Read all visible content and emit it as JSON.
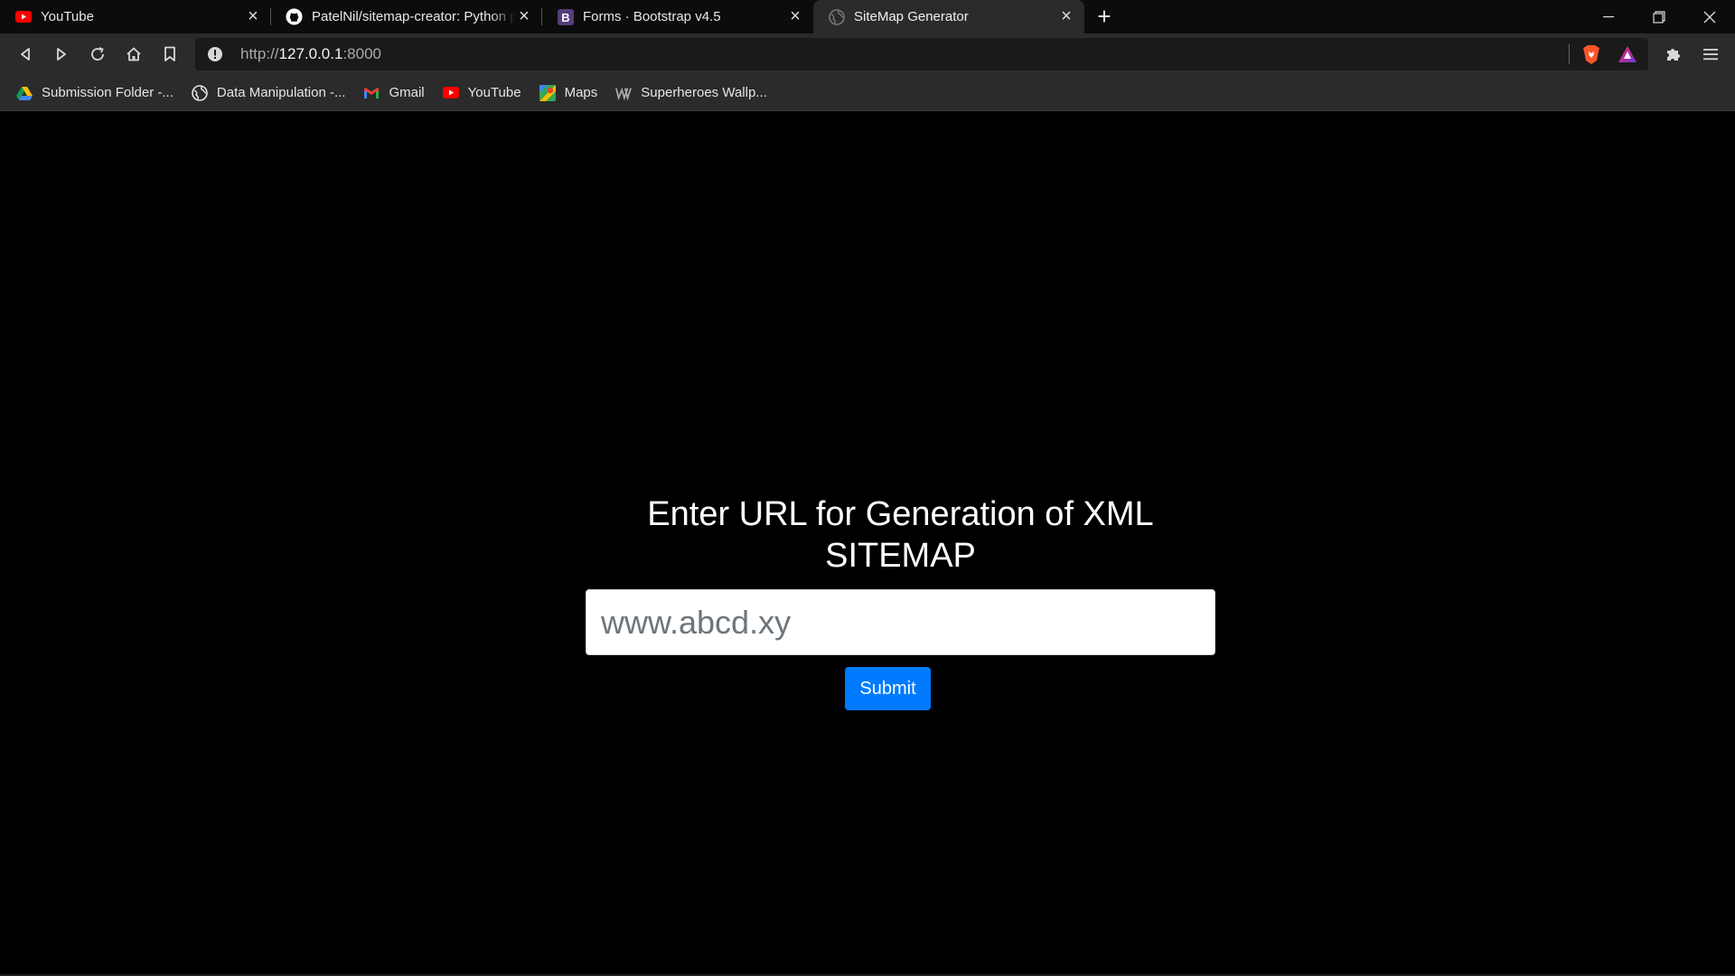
{
  "tabs": [
    {
      "title": "YouTube",
      "icon": "youtube-icon"
    },
    {
      "title": "PatelNil/sitemap-creator: Python p",
      "icon": "github-icon"
    },
    {
      "title": "Forms · Bootstrap v4.5",
      "icon": "bootstrap-icon"
    },
    {
      "title": "SiteMap Generator",
      "icon": "globe-icon",
      "active": true
    }
  ],
  "toolbar": {
    "url_prefix": "http://",
    "url_host": "127.0.0.1",
    "url_port": ":8000"
  },
  "bookmarks": [
    {
      "label": "Submission Folder -...",
      "icon": "google-drive-icon"
    },
    {
      "label": "Data Manipulation -...",
      "icon": "globe-icon"
    },
    {
      "label": "Gmail",
      "icon": "gmail-icon"
    },
    {
      "label": "YouTube",
      "icon": "youtube-icon"
    },
    {
      "label": "Maps",
      "icon": "maps-icon"
    },
    {
      "label": "Superheroes Wallp...",
      "icon": "wallpaper-icon"
    }
  ],
  "main": {
    "heading": "Enter URL for Generation of XML SITEMAP",
    "input_placeholder": "www.abcd.xy",
    "input_value": "",
    "submit_label": "Submit"
  },
  "colors": {
    "page_background": "#000000",
    "accent": "#007bff",
    "chrome": "#2b2b2b"
  }
}
